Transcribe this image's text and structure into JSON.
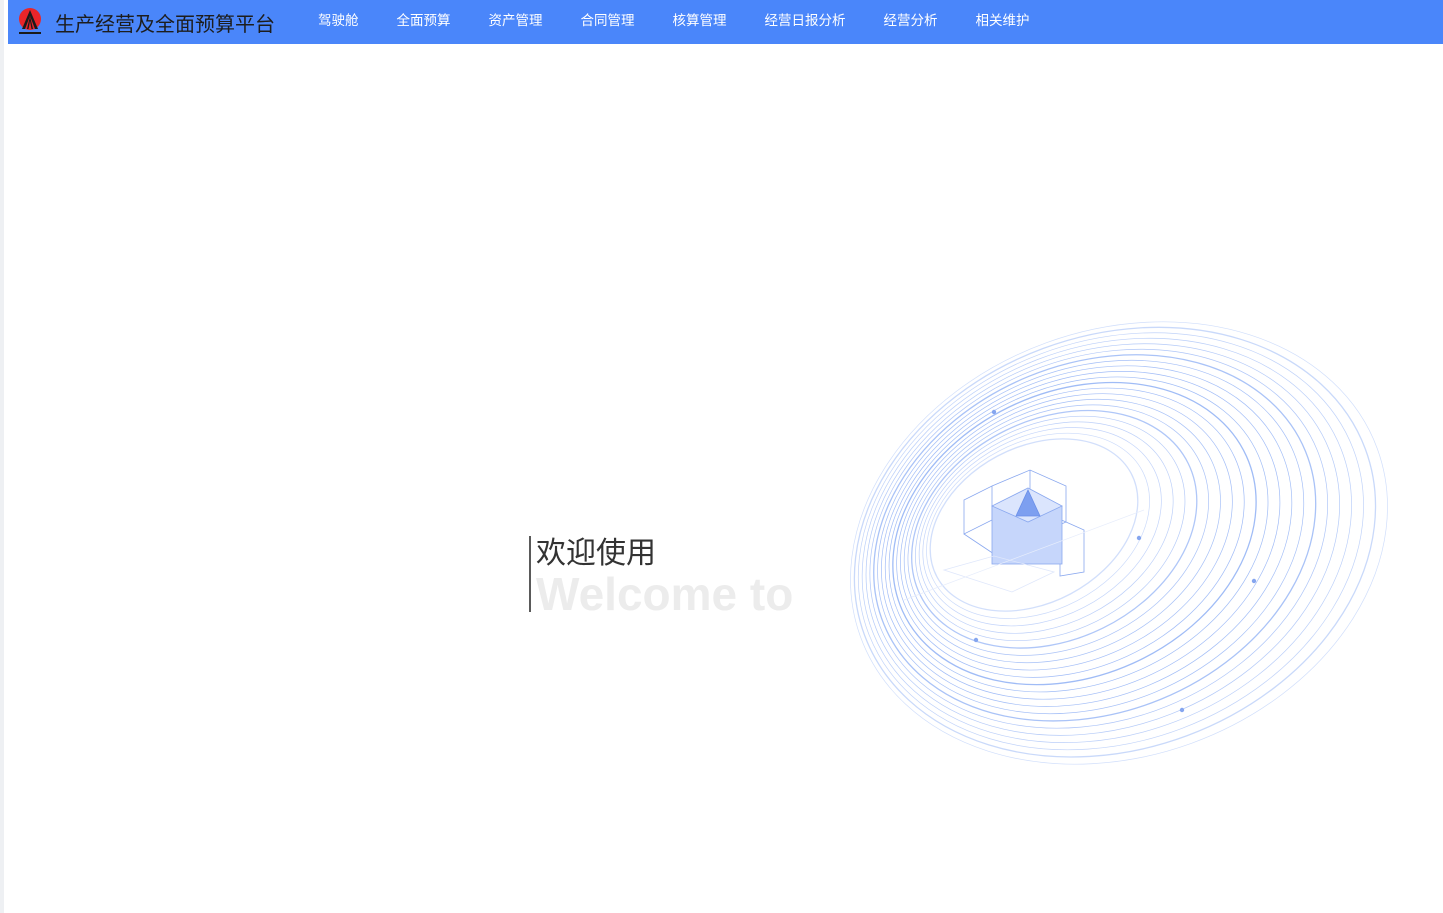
{
  "header": {
    "app_title": "生产经营及全面预算平台",
    "logo_icon": "company-logo",
    "accent_color": "#4a86fa"
  },
  "nav": {
    "items": [
      {
        "label": "驾驶舱"
      },
      {
        "label": "全面预算"
      },
      {
        "label": "资产管理"
      },
      {
        "label": "合同管理"
      },
      {
        "label": "核算管理"
      },
      {
        "label": "经营日报分析"
      },
      {
        "label": "经营分析"
      },
      {
        "label": "相关维护"
      }
    ]
  },
  "main": {
    "welcome_cn": "欢迎使用",
    "welcome_en": "Welcome to"
  }
}
